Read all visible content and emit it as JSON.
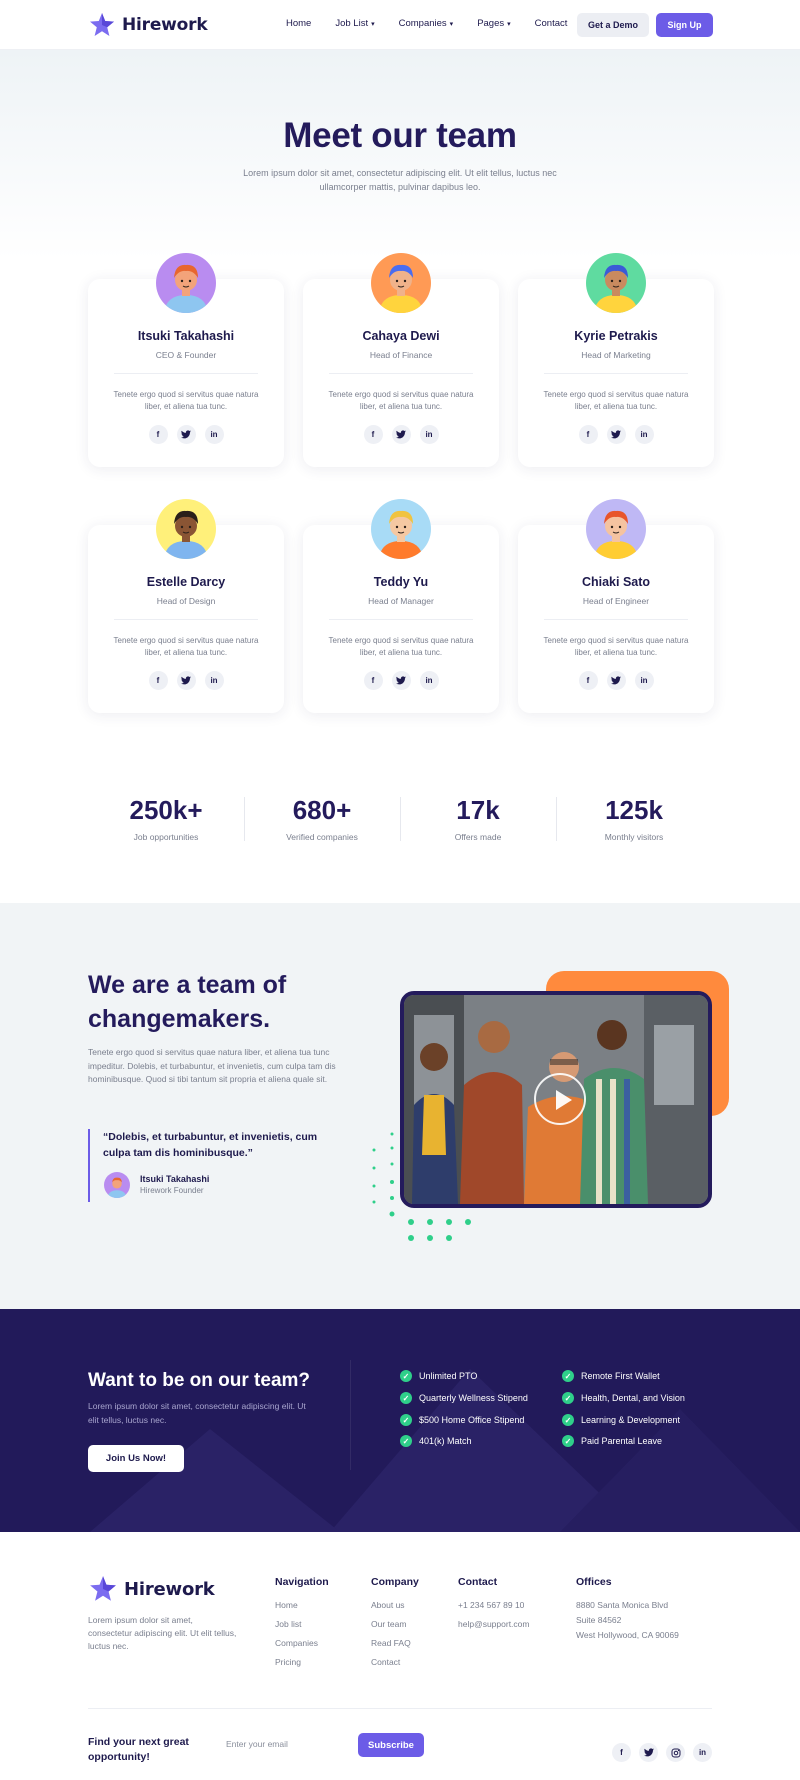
{
  "brand": {
    "name": "Hirework"
  },
  "nav": {
    "items": [
      {
        "label": "Home",
        "dropdown": false
      },
      {
        "label": "Job List",
        "dropdown": true
      },
      {
        "label": "Companies",
        "dropdown": true
      },
      {
        "label": "Pages",
        "dropdown": true
      },
      {
        "label": "Contact",
        "dropdown": false
      }
    ],
    "demo_label": "Get a Demo",
    "signup_label": "Sign Up"
  },
  "hero": {
    "title": "Meet our team",
    "subtitle": "Lorem ipsum dolor sit amet, consectetur adipiscing elit. Ut elit tellus, luctus nec ullamcorper mattis, pulvinar dapibus leo."
  },
  "team": [
    {
      "name": "Itsuki Takahashi",
      "role": "CEO & Founder",
      "desc": "Tenete ergo quod si servitus quae natura liber, et aliena tua tunc.",
      "avatar_bg": "#b98cf0",
      "hair": "#e8662f",
      "shirt": "#8ec6f0",
      "skin": "#f3a37a"
    },
    {
      "name": "Cahaya Dewi",
      "role": "Head of Finance",
      "desc": "Tenete ergo quod si servitus quae natura liber, et aliena tua tunc.",
      "avatar_bg": "#ff9a55",
      "hair": "#4a6df0",
      "shirt": "#ffd43d",
      "skin": "#f0b28a"
    },
    {
      "name": "Kyrie Petrakis",
      "role": "Head of Marketing",
      "desc": "Tenete ergo quod si servitus quae natura liber, et aliena tua tunc.",
      "avatar_bg": "#5fdba0",
      "hair": "#3b5bd6",
      "shirt": "#ffd43d",
      "skin": "#c98a5f"
    },
    {
      "name": "Estelle Darcy",
      "role": "Head of Design",
      "desc": "Tenete ergo quod si servitus quae natura liber, et aliena tua tunc.",
      "avatar_bg": "#fff07a",
      "hair": "#2a1f1a",
      "shirt": "#7fb5ef",
      "skin": "#8a5534"
    },
    {
      "name": "Teddy Yu",
      "role": "Head of Manager",
      "desc": "Tenete ergo quod si servitus quae natura liber, et aliena tua tunc.",
      "avatar_bg": "#a8dbf6",
      "hair": "#f0c340",
      "shirt": "#ff7b2c",
      "skin": "#f5c8a2"
    },
    {
      "name": "Chiaki Sato",
      "role": "Head of Engineer",
      "desc": "Tenete ergo quod si servitus quae natura liber, et aliena tua tunc.",
      "avatar_bg": "#bfb8f5",
      "hair": "#e8552b",
      "shirt": "#ffcd33",
      "skin": "#f5c3a0"
    }
  ],
  "stats": [
    {
      "value": "250k+",
      "label": "Job opportunities"
    },
    {
      "value": "680+",
      "label": "Verified companies"
    },
    {
      "value": "17k",
      "label": "Offers made"
    },
    {
      "value": "125k",
      "label": "Monthly visitors"
    }
  ],
  "changemakers": {
    "title": "We are a team of changemakers.",
    "desc": "Tenete ergo quod si servitus quae natura liber, et aliena tua tunc impeditur. Dolebis, et turbabuntur, et invenietis, cum culpa tam dis hominibusque. Quod si tibi tantum sit propria et aliena quale sit.",
    "quote": "“Dolebis, et turbabuntur, et invenietis, cum culpa tam dis hominibusque.”",
    "quote_author": "Itsuki Takahashi",
    "quote_role": "Hirework Founder"
  },
  "join": {
    "title": "Want to be on our team?",
    "subtitle": "Lorem ipsum dolor sit amet, consectetur adipiscing elit. Ut elit tellus, luctus nec.",
    "button": "Join Us Now!",
    "perks_left": [
      "Unlimited PTO",
      "Quarterly Wellness Stipend",
      "$500 Home Office Stipend",
      "401(k) Match"
    ],
    "perks_right": [
      "Remote First Wallet",
      "Health, Dental, and Vision",
      "Learning & Development",
      "Paid Parental Leave"
    ]
  },
  "footer": {
    "desc": "Lorem ipsum dolor sit amet, consectetur adipiscing elit. Ut elit tellus, luctus nec.",
    "columns": [
      {
        "title": "Navigation",
        "links": [
          "Home",
          "Job list",
          "Companies",
          "Pricing"
        ]
      },
      {
        "title": "Company",
        "links": [
          "About us",
          "Our team",
          "Read FAQ",
          "Contact"
        ]
      },
      {
        "title": "Contact",
        "links": [
          "+1 234 567 89 10",
          "help@support.com"
        ]
      },
      {
        "title": "Offices",
        "links": [
          "8880 Santa Monica Blvd",
          "Suite 84562",
          "West Hollywood, CA 90069"
        ]
      }
    ],
    "cta": "Find your next great opportunity!",
    "email_placeholder": "Enter your email",
    "subscribe": "Subscribe"
  },
  "colors": {
    "primary": "#6c5ce7",
    "navy": "#241b5c",
    "orange": "#ff8a3d",
    "green": "#2fcf8a"
  }
}
